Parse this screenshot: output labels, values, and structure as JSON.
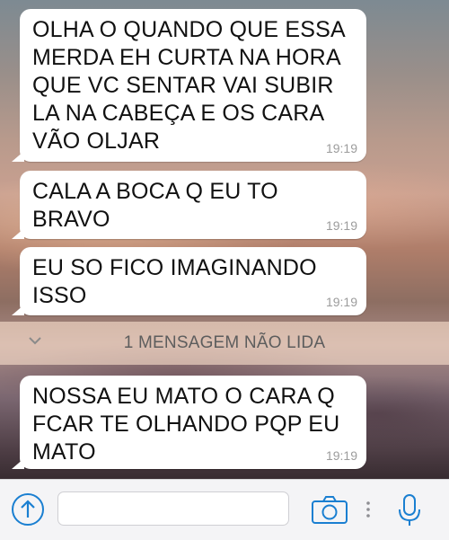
{
  "messages": [
    {
      "text": "OLHA O QUANDO QUE ESSA\nMERDA EH CURTA NA HORA\nQUE VC SENTAR VAI SUBIR\nLA NA CABEÇA E OS CARA\nVÃO OLJAR",
      "time": "19:19"
    },
    {
      "text": "CALA A BOCA Q EU TO\nBRAVO",
      "time": "19:19"
    },
    {
      "text": "EU SO FICO IMAGINANDO\nISSO",
      "time": "19:19"
    },
    {
      "text": "NOSSA EU MATO O CARA Q\nFCAR TE OLHANDO PQP EU\nMATO",
      "time": "19:19"
    }
  ],
  "unread_divider": {
    "label": "1 MENSAGEM NÃO LIDA"
  },
  "input_bar": {
    "message_value": "",
    "upload_icon": "upload-arrow-icon",
    "camera_icon": "camera-icon",
    "more_icon": "more-vertical-icon",
    "mic_icon": "microphone-icon",
    "accent_color": "#1a7fd1"
  }
}
